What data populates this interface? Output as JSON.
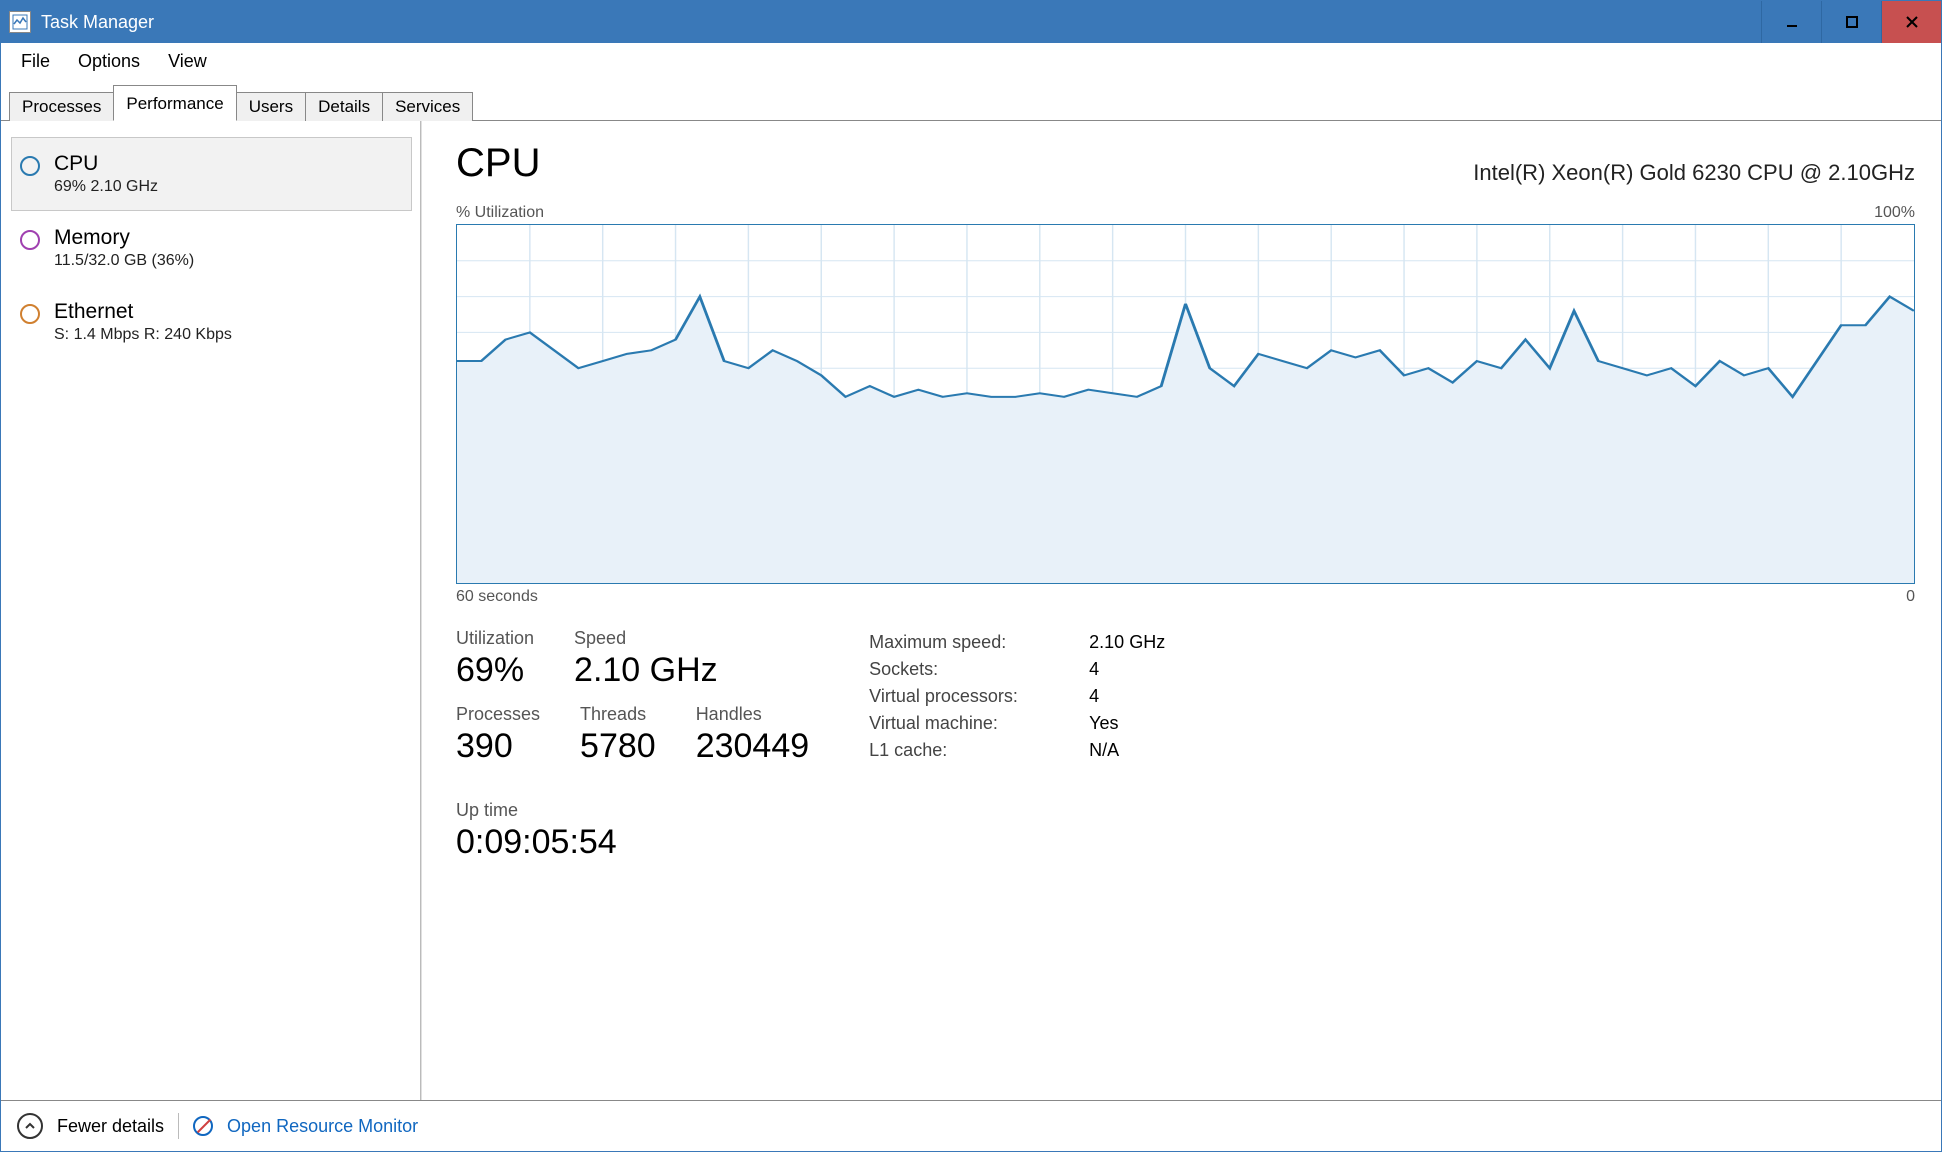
{
  "window": {
    "title": "Task Manager"
  },
  "menu": {
    "file": "File",
    "options": "Options",
    "view": "View"
  },
  "tabs": {
    "processes": "Processes",
    "performance": "Performance",
    "users": "Users",
    "details": "Details",
    "services": "Services"
  },
  "sidebar": {
    "cpu": {
      "title": "CPU",
      "sub": "69% 2.10 GHz",
      "color": "#2a7ab0"
    },
    "memory": {
      "title": "Memory",
      "sub": "11.5/32.0 GB (36%)",
      "color": "#a040b0"
    },
    "ethernet": {
      "title": "Ethernet",
      "sub": "S: 1.4 Mbps R: 240 Kbps",
      "color": "#d08030"
    }
  },
  "detail": {
    "title": "CPU",
    "full_name": "Intel(R) Xeon(R) Gold 6230 CPU @ 2.10GHz",
    "chart_top_left": "% Utilization",
    "chart_top_right": "100%",
    "chart_bot_left": "60 seconds",
    "chart_bot_right": "0",
    "utilization_label": "Utilization",
    "utilization": "69%",
    "speed_label": "Speed",
    "speed": "2.10 GHz",
    "processes_label": "Processes",
    "processes": "390",
    "threads_label": "Threads",
    "threads": "5780",
    "handles_label": "Handles",
    "handles": "230449",
    "uptime_label": "Up time",
    "uptime": "0:09:05:54",
    "kv": {
      "max_speed_k": "Maximum speed:",
      "max_speed_v": "2.10 GHz",
      "sockets_k": "Sockets:",
      "sockets_v": "4",
      "vprocs_k": "Virtual processors:",
      "vprocs_v": "4",
      "vm_k": "Virtual machine:",
      "vm_v": "Yes",
      "l1_k": "L1 cache:",
      "l1_v": "N/A"
    }
  },
  "footer": {
    "fewer": "Fewer details",
    "resmon": "Open Resource Monitor"
  },
  "chart_data": {
    "type": "line",
    "title": "% Utilization",
    "xlabel": "60 seconds",
    "ylabel": "% Utilization",
    "ylim": [
      0,
      100
    ],
    "x_seconds_ago": [
      60,
      59,
      58,
      57,
      56,
      55,
      54,
      53,
      52,
      51,
      50,
      49,
      48,
      47,
      46,
      45,
      44,
      43,
      42,
      41,
      40,
      39,
      38,
      37,
      36,
      35,
      34,
      33,
      32,
      31,
      30,
      29,
      28,
      27,
      26,
      25,
      24,
      23,
      22,
      21,
      20,
      19,
      18,
      17,
      16,
      15,
      14,
      13,
      12,
      11,
      10,
      9,
      8,
      7,
      6,
      5,
      4,
      3,
      2,
      1,
      0
    ],
    "values": [
      62,
      62,
      68,
      70,
      65,
      60,
      62,
      64,
      65,
      68,
      80,
      62,
      60,
      65,
      62,
      58,
      52,
      55,
      52,
      54,
      52,
      53,
      52,
      52,
      53,
      52,
      54,
      53,
      52,
      55,
      78,
      60,
      55,
      64,
      62,
      60,
      65,
      63,
      65,
      58,
      60,
      56,
      62,
      60,
      68,
      60,
      76,
      62,
      60,
      58,
      60,
      55,
      62,
      58,
      60,
      52,
      62,
      72,
      72,
      80,
      76
    ]
  }
}
